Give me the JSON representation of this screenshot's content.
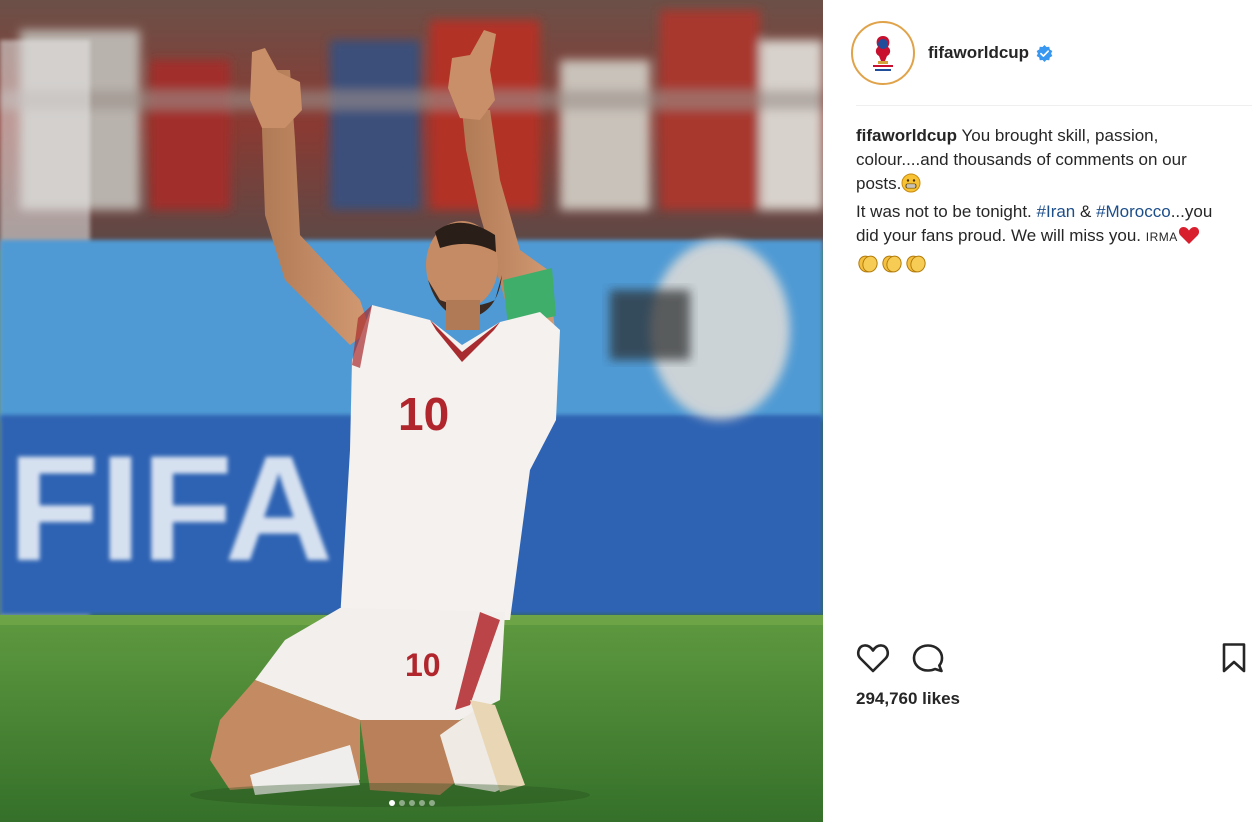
{
  "post": {
    "username": "fifaworldcup",
    "verified": true,
    "avatar_icon": "fifa-world-cup-russia-2018-logo",
    "caption": {
      "username": "fifaworldcup",
      "line1": " You brought skill, passion, colour....and thousands of comments on our posts.",
      "line2": "It was not to be tonight. ",
      "hashtag1": "#Iran",
      "amp": " & ",
      "hashtag2": "#Morocco",
      "line3": "...you did your fans proud. We will miss you. ",
      "signature": "IRMA",
      "emojis": [
        "grinning-face",
        "red-heart",
        "clapping-hands",
        "clapping-hands",
        "clapping-hands"
      ]
    },
    "likes_text": "294,760 likes",
    "carousel": {
      "count": 5,
      "active": 0
    },
    "photo": {
      "jersey_number": "10",
      "banner_text": "FIFA"
    }
  },
  "colors": {
    "accent_link": "#1c4e8a",
    "verified_blue": "#3897f0",
    "text": "#262626",
    "divider": "#efefef"
  },
  "icons": {
    "like": "heart-icon",
    "comment": "comment-icon",
    "save": "bookmark-icon"
  }
}
